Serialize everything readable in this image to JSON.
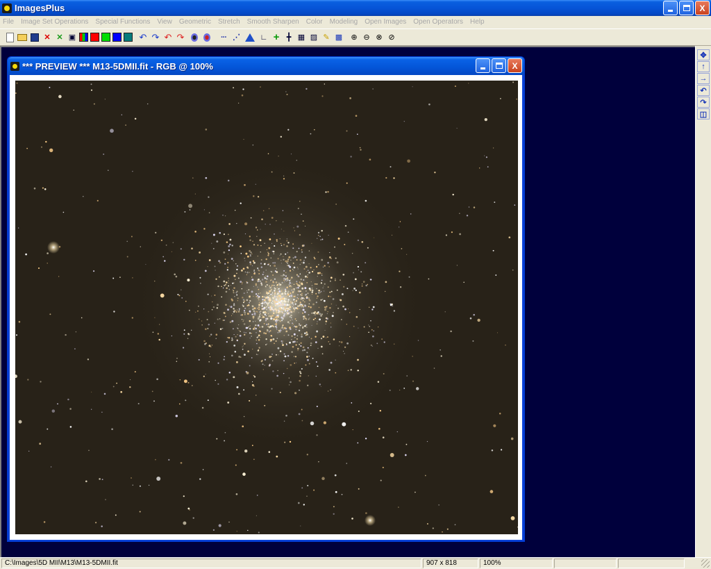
{
  "window": {
    "title": "ImagesPlus",
    "buttons": {
      "minimize": "_",
      "maximize": "□",
      "close": "X"
    }
  },
  "menu": {
    "items": [
      "File",
      "Image Set Operations",
      "Special Functions",
      "View",
      "Geometric",
      "Stretch",
      "Smooth Sharpen",
      "Color",
      "Modeling",
      "Open Images",
      "Open Operators",
      "Help"
    ]
  },
  "toolbar": {
    "icons": [
      "new-file-icon",
      "open-folder-icon",
      "save-icon",
      "close-red-x-icon",
      "close-green-x-icon",
      "print-icon",
      "rgb-channels-icon",
      "red-channel-icon",
      "green-channel-icon",
      "blue-channel-icon",
      "grid-icon",
      "undo-icon",
      "redo-icon",
      "undo-red-icon",
      "redo-red-icon",
      "circle-select-icon",
      "circle-select-red-icon",
      "dot-line-icon",
      "dot-plot-icon",
      "triangle-icon",
      "corner-icon",
      "plus-green-icon",
      "crosshair-icon",
      "grid-small-icon",
      "picture-icon",
      "pencil-icon",
      "checker-icon",
      "zoom-in-icon",
      "zoom-out-icon",
      "zoom-fit-icon",
      "zoom-actual-icon"
    ]
  },
  "preview": {
    "title": "*** PREVIEW *** M13-5DMII.fit - RGB @  100%"
  },
  "right_strip": {
    "icons": [
      "move-icon",
      "arrow-up-icon",
      "arrow-right-icon",
      "rotate-left-icon",
      "rotate-right-icon",
      "flip-icon"
    ],
    "glyphs": [
      "✥",
      "↑",
      "→",
      "↶",
      "↷",
      "◫"
    ]
  },
  "statusbar": {
    "path": "C:\\Images\\5D MII\\M13\\M13-5DMII.fit",
    "dimensions": "907 x 818",
    "zoom": "100%"
  },
  "colors": {
    "xp_blue": "#0454d7",
    "workspace": "#00003c",
    "sky": "#282218"
  }
}
